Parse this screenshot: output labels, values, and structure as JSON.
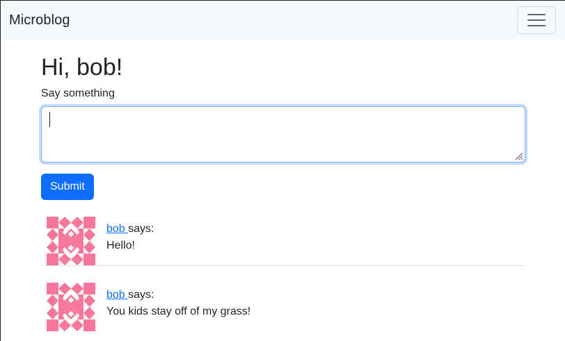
{
  "navbar": {
    "brand": "Microblog",
    "toggler_icon": "hamburger-menu-icon"
  },
  "main": {
    "greeting": "Hi, bob!",
    "form": {
      "label": "Say something",
      "textarea_value": "",
      "submit_label": "Submit"
    },
    "posts": [
      {
        "author": "bob",
        "says": "says:",
        "body": "Hello!",
        "avatar_icon": "identicon-avatar"
      },
      {
        "author": "bob",
        "says": "says:",
        "body": "You kids stay off of my grass!",
        "avatar_icon": "identicon-avatar"
      }
    ]
  },
  "colors": {
    "primary": "#0d6efd",
    "navbar_bg": "#f8f9fa",
    "avatar_pink": "#f7779a"
  }
}
